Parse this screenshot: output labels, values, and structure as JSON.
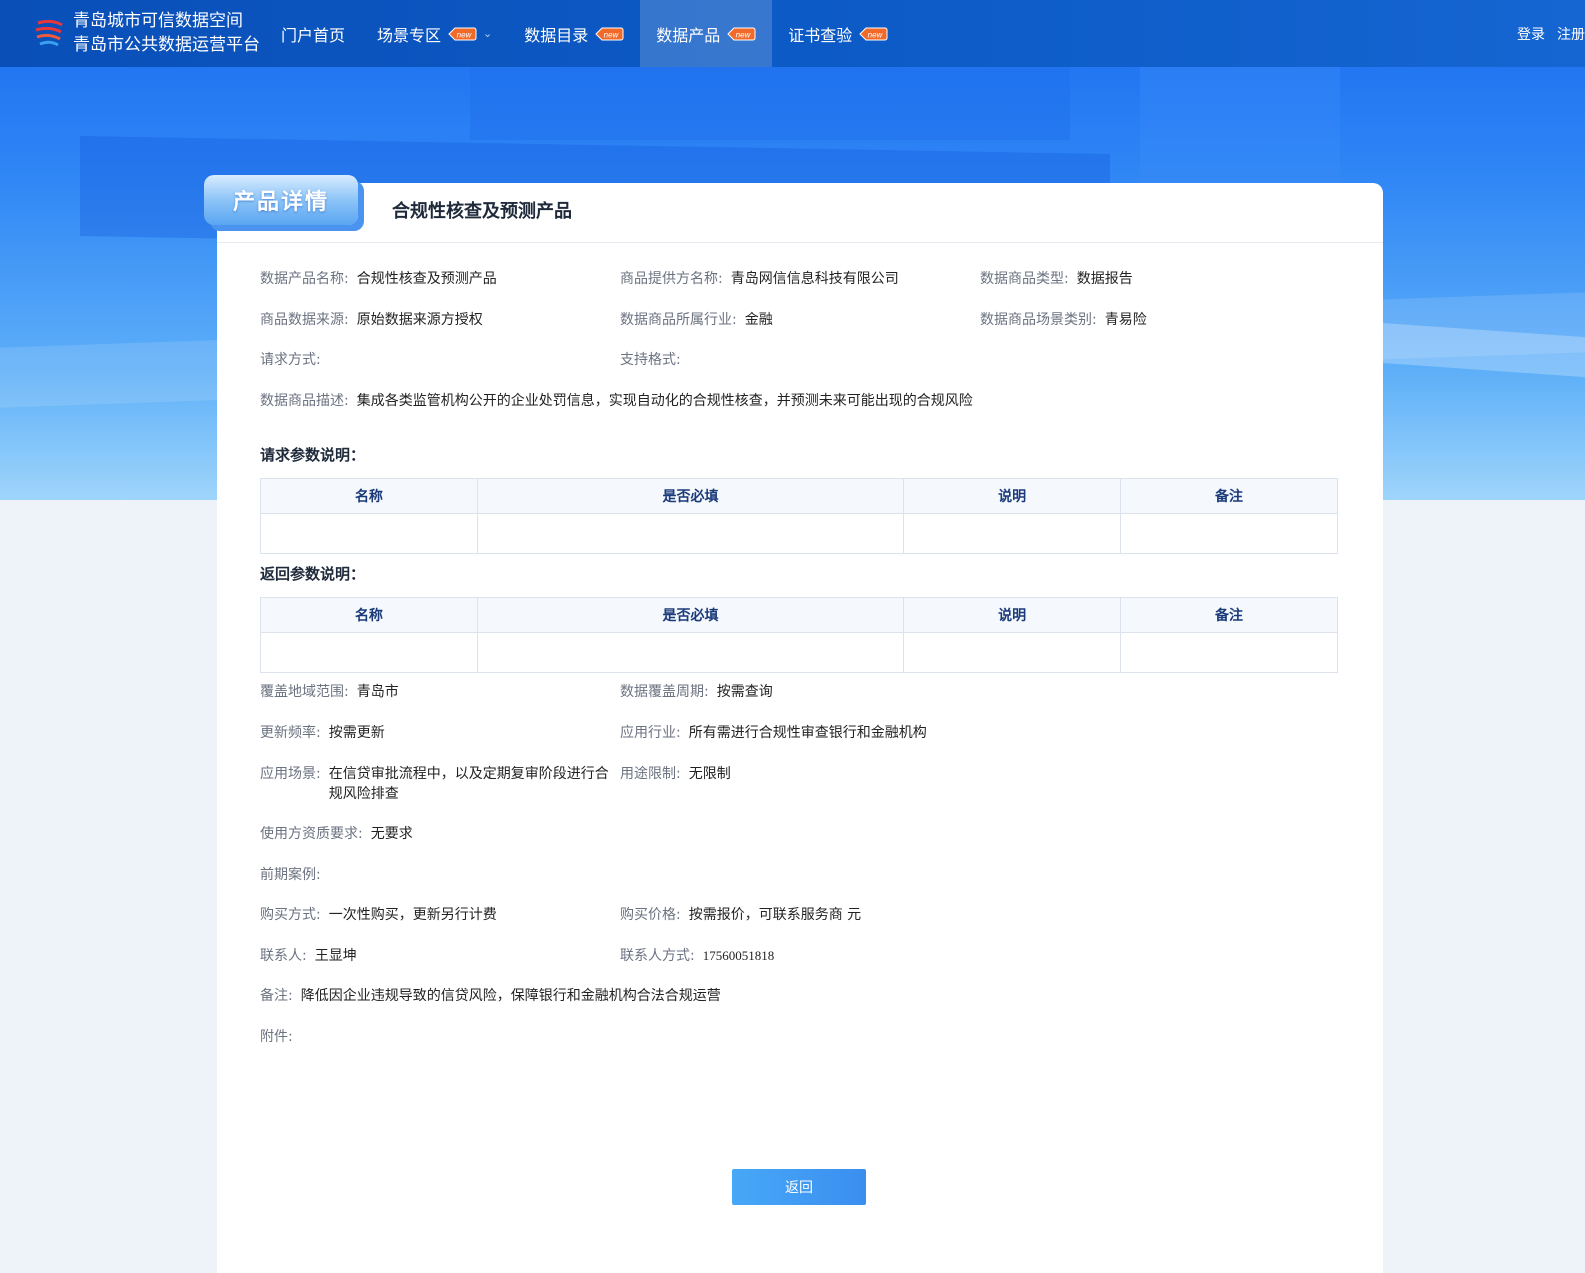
{
  "brand": {
    "line1": "青岛城市可信数据空间",
    "line2": "青岛市公共数据运营平台"
  },
  "nav": {
    "items": [
      {
        "label": "门户首页"
      },
      {
        "label": "场景专区",
        "badge": "new"
      },
      {
        "label": "数据目录",
        "badge": "new"
      },
      {
        "label": "数据产品",
        "badge": "new"
      },
      {
        "label": "证书查验",
        "badge": "new"
      }
    ],
    "login": "登录",
    "register": "注册"
  },
  "page": {
    "tab": "产品详情",
    "title": "合规性核查及预测产品"
  },
  "fields": {
    "product_name": {
      "label": "数据产品名称:",
      "value": "合规性核查及预测产品"
    },
    "provider": {
      "label": "商品提供方名称:",
      "value": "青岛网信信息科技有限公司"
    },
    "type": {
      "label": "数据商品类型:",
      "value": "数据报告"
    },
    "source": {
      "label": "商品数据来源:",
      "value": "原始数据来源方授权"
    },
    "industry": {
      "label": "数据商品所属行业:",
      "value": "金融"
    },
    "scene_cat": {
      "label": "数据商品场景类别:",
      "value": "青易险"
    },
    "request_method": {
      "label": "请求方式:",
      "value": ""
    },
    "formats": {
      "label": "支持格式:",
      "value": ""
    },
    "description": {
      "label": "数据商品描述:",
      "value": "集成各类监管机构公开的企业处罚信息，实现自动化的合规性核查，并预测未来可能出现的合规风险"
    },
    "region": {
      "label": "覆盖地域范围:",
      "value": "青岛市"
    },
    "period": {
      "label": "数据覆盖周期:",
      "value": "按需查询"
    },
    "frequency": {
      "label": "更新频率:",
      "value": "按需更新"
    },
    "app_industry": {
      "label": "应用行业:",
      "value": "所有需进行合规性审查银行和金融机构"
    },
    "scenario": {
      "label": "应用场景:",
      "value": "在信贷审批流程中，以及定期复审阶段进行合规风险排查"
    },
    "usage_limit": {
      "label": "用途限制:",
      "value": "无限制"
    },
    "qualification": {
      "label": "使用方资质要求:",
      "value": "无要求"
    },
    "cases": {
      "label": "前期案例:",
      "value": ""
    },
    "purchase_method": {
      "label": "购买方式:",
      "value": "一次性购买，更新另行计费"
    },
    "price": {
      "label": "购买价格:",
      "value": "按需报价，可联系服务商 元"
    },
    "contact": {
      "label": "联系人:",
      "value": "王显坤"
    },
    "contact_phone": {
      "label": "联系人方式:",
      "value": "17560051818"
    },
    "remark": {
      "label": "备注:",
      "value": "降低因企业违规导致的信贷风险，保障银行和金融机构合法合规运营"
    },
    "attachment": {
      "label": "附件:",
      "value": ""
    }
  },
  "request_params": {
    "title": "请求参数说明：",
    "columns": [
      "名称",
      "是否必填",
      "说明",
      "备注"
    ]
  },
  "response_params": {
    "title": "返回参数说明：",
    "columns": [
      "名称",
      "是否必填",
      "说明",
      "备注"
    ]
  },
  "actions": {
    "back": "返回"
  },
  "colors": {
    "nav": "#0d5cc8",
    "accent": "#3b8ef0",
    "badge": "#f26a2a"
  }
}
